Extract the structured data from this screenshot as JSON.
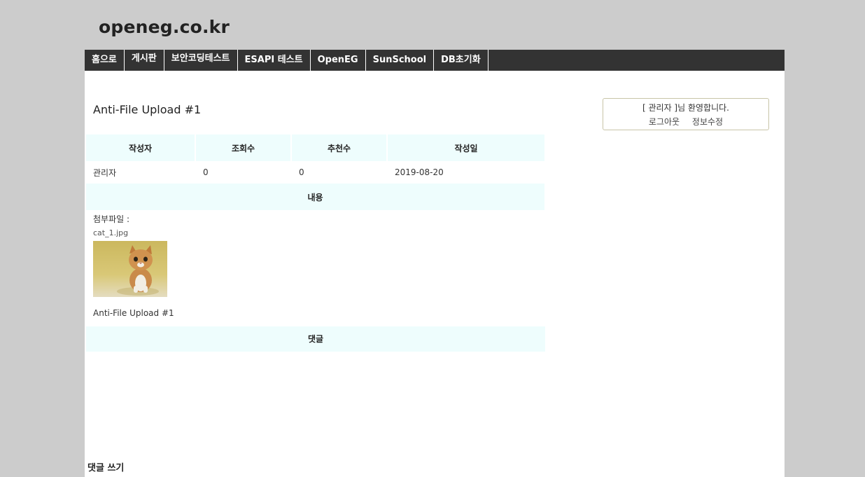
{
  "site": {
    "title": "openeg.co.kr"
  },
  "nav": {
    "items": [
      {
        "label": "홈으로"
      },
      {
        "label": "게시판"
      },
      {
        "label": "보안코딩테스트"
      },
      {
        "label": "ESAPI 테스트"
      },
      {
        "label": "OpenEG"
      },
      {
        "label": "SunSchool"
      },
      {
        "label": "DB초기화"
      }
    ]
  },
  "post": {
    "title": "Anti-File Upload #1",
    "headers": {
      "author": "작성자",
      "views": "조회수",
      "recommends": "추천수",
      "date": "작성일"
    },
    "values": {
      "author": "관리자",
      "views": "0",
      "recommends": "0",
      "date": "2019-08-20"
    },
    "content_header": "내용",
    "attachment_label": "첨부파일 :",
    "attachment_file": "cat_1.jpg",
    "body": "Anti-File Upload #1"
  },
  "comments": {
    "header": "댓글",
    "write_label": "댓글 쓰기"
  },
  "login": {
    "welcome": "[ 관리자 ]님 환영합니다.",
    "logout": "로그아웃",
    "edit_profile": "정보수정"
  },
  "icons": {
    "attachment_image": "kitten-photo"
  }
}
